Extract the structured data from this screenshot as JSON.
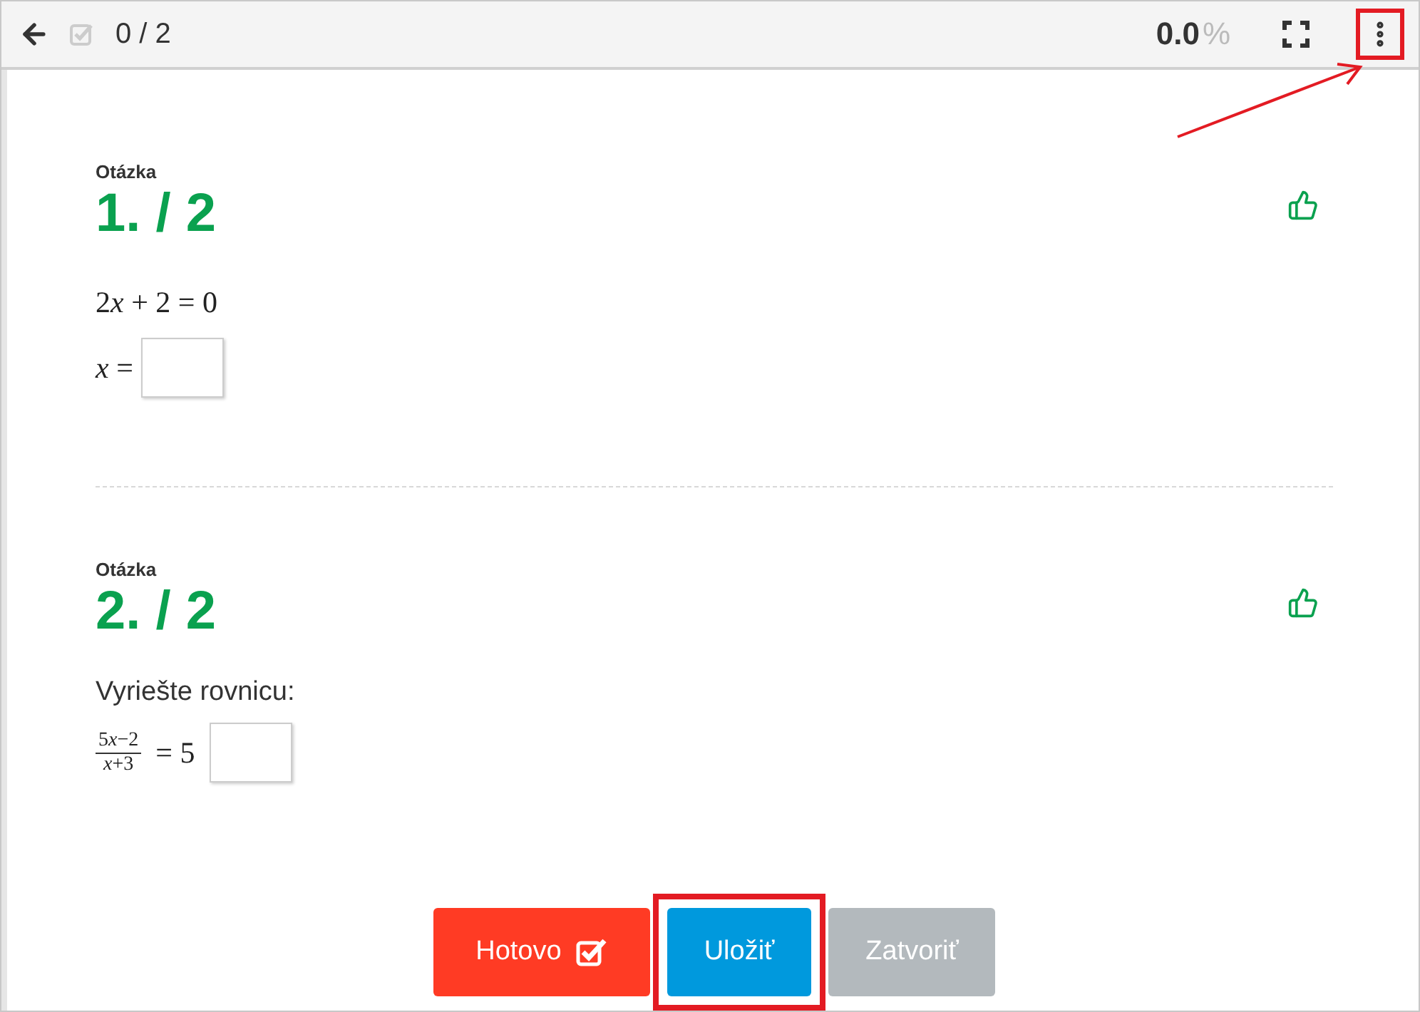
{
  "toolbar": {
    "progress": "0 / 2",
    "percent_value": "0.0",
    "percent_sign": "%",
    "menu_highlighted": true
  },
  "questions": [
    {
      "kind": "equation",
      "label": "Otázka",
      "number": "1. / 2",
      "equation": [
        {
          "kind": "number",
          "text": "2"
        },
        {
          "kind": "variable",
          "text": "x"
        },
        {
          "kind": "number",
          "text": " + 2 = 0"
        }
      ],
      "answer_prefix": "*x* ="
    },
    {
      "kind": "fraction",
      "label": "Otázka",
      "number": "2. / 2",
      "prompt": "Vyriešte rovnicu:",
      "numerator": [
        {
          "kind": "number",
          "text": "5"
        },
        {
          "kind": "variable",
          "text": "x"
        },
        {
          "kind": "number",
          "text": "−2"
        }
      ],
      "denominator": [
        {
          "kind": "variable",
          "text": "x"
        },
        {
          "kind": "number",
          "text": "+3"
        }
      ],
      "rhs": "= 5"
    }
  ],
  "buttons": [
    {
      "kind": "done",
      "label": "Hotovo",
      "highlighted": false
    },
    {
      "kind": "save",
      "label": "Uložiť",
      "highlighted": true
    },
    {
      "kind": "close",
      "label": "Zatvoriť",
      "highlighted": false
    }
  ]
}
